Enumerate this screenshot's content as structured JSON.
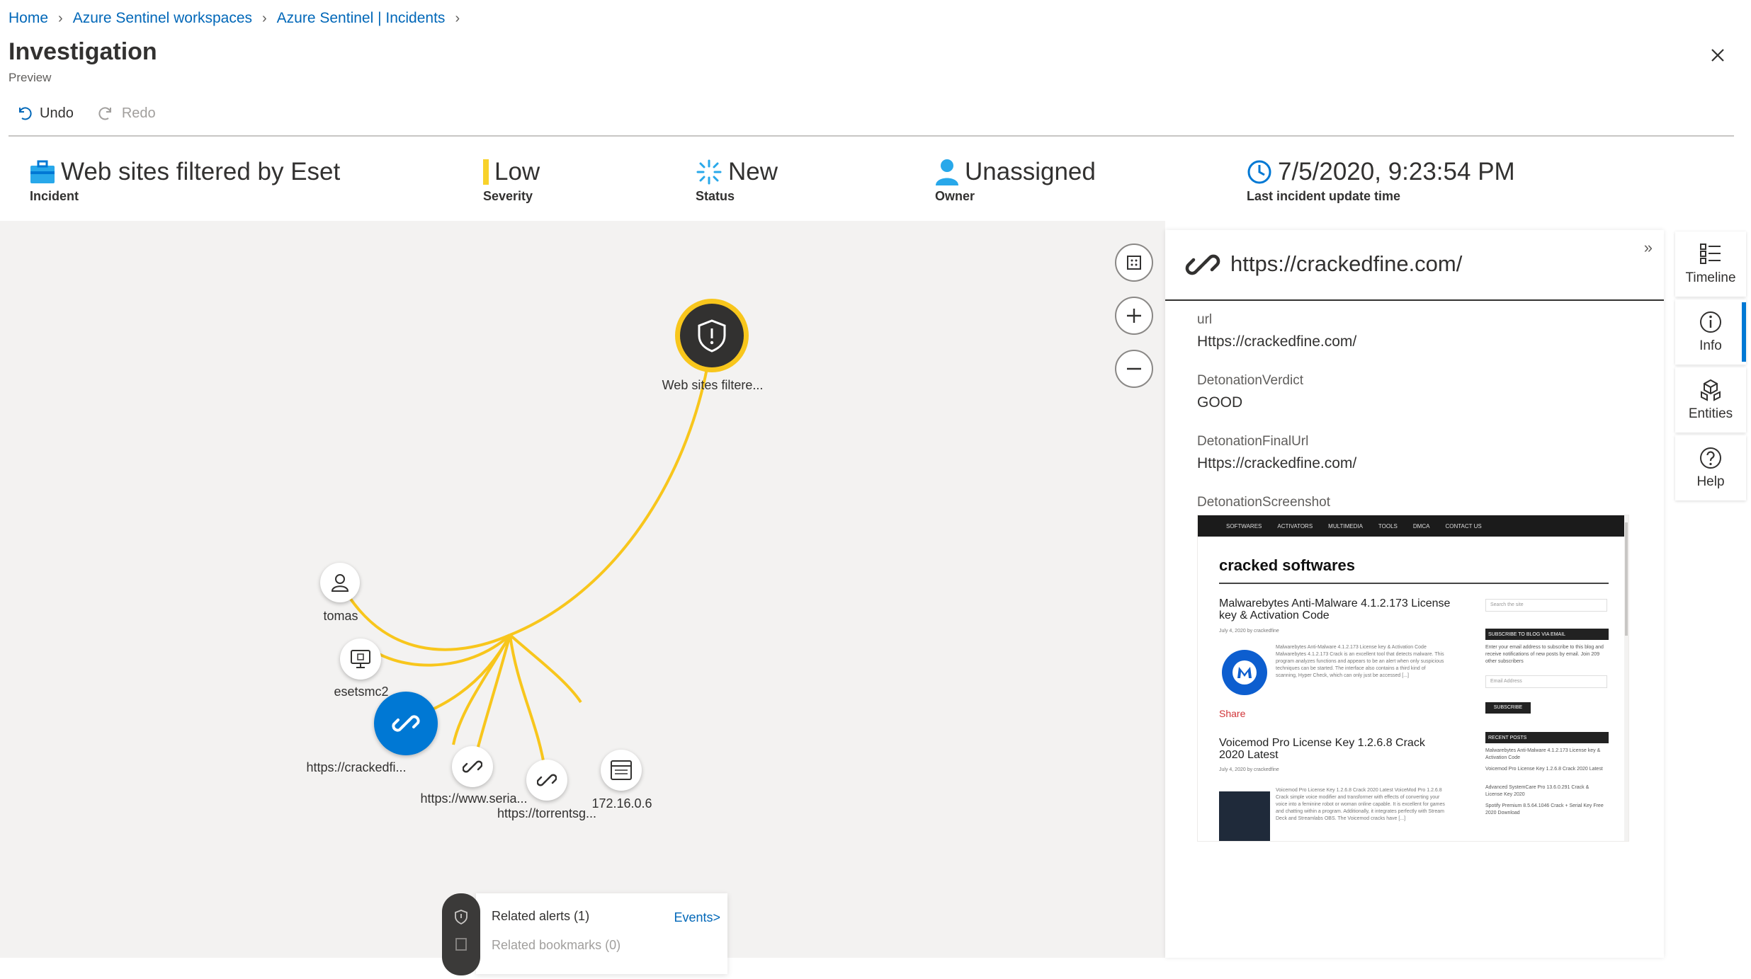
{
  "breadcrumb": [
    "Home",
    "Azure Sentinel workspaces",
    "Azure Sentinel | Incidents"
  ],
  "page": {
    "title": "Investigation",
    "subtitle": "Preview"
  },
  "toolbar": {
    "undo": "Undo",
    "redo": "Redo"
  },
  "summary": {
    "incident": {
      "value": "Web sites filtered by Eset",
      "label": "Incident"
    },
    "severity": {
      "value": "Low",
      "label": "Severity",
      "color": "#f8d22a"
    },
    "status": {
      "value": "New",
      "label": "Status"
    },
    "owner": {
      "value": "Unassigned",
      "label": "Owner"
    },
    "updated": {
      "value": "7/5/2020, 9:23:54 PM",
      "label": "Last incident update time"
    }
  },
  "graph": {
    "edge_color": "#f8c61c",
    "alert_node": {
      "label": "Web sites filtere...",
      "icon": "shield-alert-icon"
    },
    "entities": [
      {
        "id": "tomas",
        "label": "tomas",
        "icon": "user-icon"
      },
      {
        "id": "esetsmc2",
        "label": "esetsmc2",
        "icon": "computer-icon"
      },
      {
        "id": "crackedfine",
        "label": "https://crackedfi...",
        "icon": "link-icon",
        "selected": true
      },
      {
        "id": "serial",
        "label": "https://www.seria...",
        "icon": "link-icon"
      },
      {
        "id": "torrents",
        "label": "https://torrentsg...",
        "icon": "link-icon"
      },
      {
        "id": "ip",
        "label": "172.16.0.6",
        "icon": "ip-icon"
      }
    ],
    "popup": {
      "related_alerts": "Related alerts (1)",
      "related_bookmarks": "Related bookmarks (0)",
      "events_link": "Events>"
    }
  },
  "panel": {
    "title": "https://crackedfine.com/",
    "fields": [
      {
        "label": "url",
        "value": "Https://crackedfine.com/"
      },
      {
        "label": "DetonationVerdict",
        "value": "GOOD"
      },
      {
        "label": "DetonationFinalUrl",
        "value": "Https://crackedfine.com/"
      },
      {
        "label": "DetonationScreenshot",
        "value": ""
      }
    ],
    "screenshot": {
      "nav": [
        "SOFTWARES",
        "ACTIVATORS",
        "MULTIMEDIA",
        "TOOLS",
        "DMCA",
        "CONTACT US"
      ],
      "site_title": "cracked softwares",
      "post1_title": "Malwarebytes Anti-Malware 4.1.2.173 License key & Activation Code",
      "post1_meta": "July 4, 2020 by crackedfine",
      "post1_text": "Malwarebytes Anti-Malware 4.1.2.173 License key & Activation Code Malwarebytes 4.1.2.173 Crack is an excellent tool that detects malware. This program analyzes functions and appears to be an alert when only suspicious techniques can be started. The interface also contains a third kind of scanning, Hyper Check, which can only just be accessed [...]",
      "share": "Share",
      "post2_title": "Voicemod Pro License Key 1.2.6.8 Crack 2020 Latest",
      "post2_meta": "July 4, 2020 by crackedfine",
      "post2_text": "Voicemod Pro License Key 1.2.6.8 Crack 2020 Latest VoiceMod Pro 1.2.6.8 Crack simple voice modifier and transformer with effects of converting your voice into a feminine robot or woman online capable. It is excellent for games and chatting within a program. Additionally, it integrates perfectly with Stream Deck and Streamlabs OBS. The Voicemod cracks have [...]",
      "search_placeholder": "Search the site",
      "subscribe_header": "SUBSCRIBE TO BLOG VIA EMAIL",
      "subscribe_text": "Enter your email address to subscribe to this blog and receive notifications of new posts by email. Join 209 other subscribers",
      "email_placeholder": "Email Address",
      "subscribe_btn": "SUBSCRIBE",
      "recent_header": "RECENT POSTS",
      "recent": [
        "Malwarebytes Anti-Malware 4.1.2.173 License key & Activation Code",
        "Voicemod Pro License Key 1.2.6.8 Crack 2020 Latest",
        "Advanced SystemCare Pro 13.6.0.291 Crack & License Key 2020",
        "Spotify Premium 8.5.64.1046 Crack + Serial Key Free 2020 Download"
      ]
    }
  },
  "rail": [
    {
      "label": "Timeline",
      "icon": "timeline-icon"
    },
    {
      "label": "Info",
      "icon": "info-icon",
      "active": true
    },
    {
      "label": "Entities",
      "icon": "entities-icon"
    },
    {
      "label": "Help",
      "icon": "help-icon"
    }
  ]
}
